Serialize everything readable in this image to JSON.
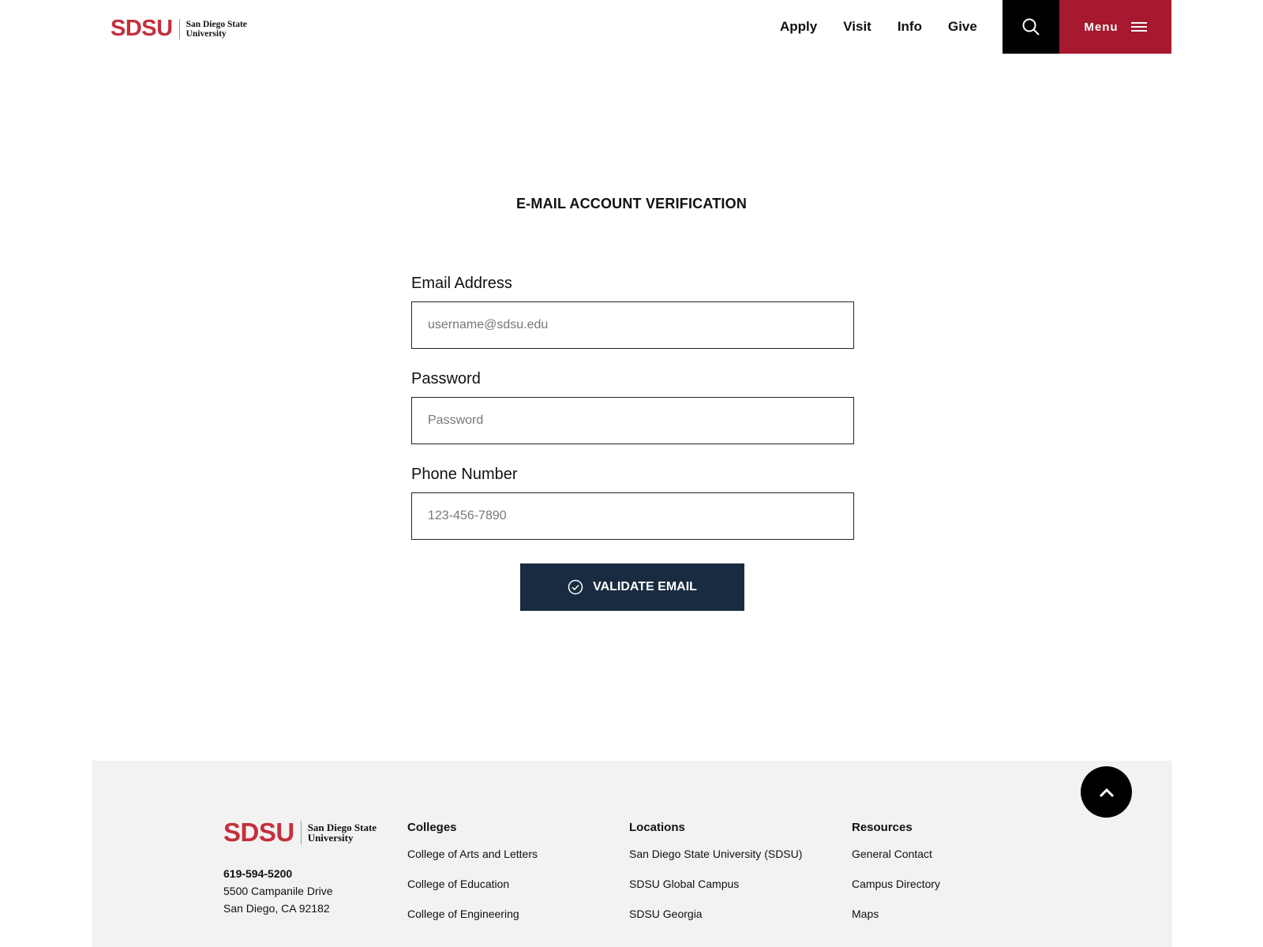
{
  "header": {
    "logo": {
      "mark": "SDSU",
      "line1": "San Diego State",
      "line2": "University"
    },
    "nav": [
      "Apply",
      "Visit",
      "Info",
      "Give"
    ],
    "menu_label": "Menu"
  },
  "form": {
    "title": "E-MAIL ACCOUNT VERIFICATION",
    "email": {
      "label": "Email Address",
      "placeholder": "username@sdsu.edu"
    },
    "password": {
      "label": "Password",
      "placeholder": "Password"
    },
    "phone": {
      "label": "Phone Number",
      "placeholder": "123-456-7890"
    },
    "submit_label": "VALIDATE EMAIL"
  },
  "footer": {
    "logo": {
      "mark": "SDSU",
      "line1": "San Diego State",
      "line2": "University"
    },
    "phone": "619-594-5200",
    "address1": "5500 Campanile Drive",
    "address2": "San Diego, CA 92182",
    "columns": [
      {
        "title": "Colleges",
        "links": [
          "College of Arts and Letters",
          "College of Education",
          "College of Engineering"
        ]
      },
      {
        "title": "Locations",
        "links": [
          "San Diego State University (SDSU)",
          "SDSU Global Campus",
          "SDSU Georgia"
        ]
      },
      {
        "title": "Resources",
        "links": [
          "General Contact",
          "Campus Directory",
          "Maps"
        ]
      }
    ]
  },
  "colors": {
    "brand_red": "#c4303c",
    "menu_red": "#a6192e",
    "button_navy": "#182b40",
    "footer_bg": "#f2f2f2"
  },
  "icons": {
    "search": "search-icon",
    "menu": "hamburger-icon",
    "check": "check-circle-icon",
    "to_top": "chevron-up-icon"
  }
}
